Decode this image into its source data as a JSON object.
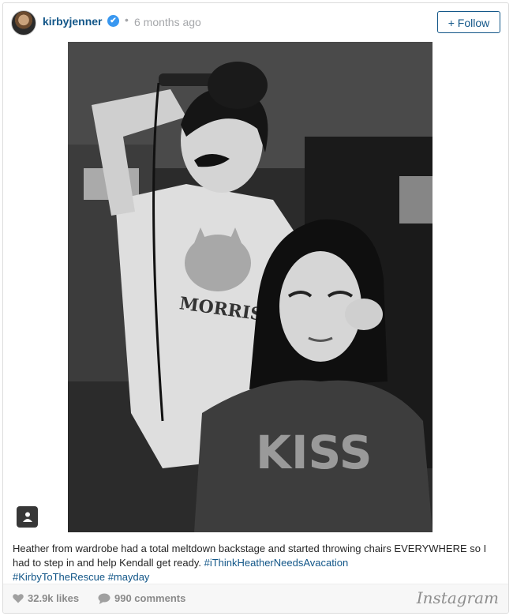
{
  "header": {
    "username": "kirbyjenner",
    "verified_mark": "✔",
    "separator": "•",
    "timestamp": "6 months ago",
    "follow_label": "+ Follow"
  },
  "caption": {
    "text": "Heather from wardrobe had a total meltdown backstage and started throwing chairs EVERYWHERE so I had to step in and help Kendall get ready. ",
    "hashtags": [
      "#iThinkHeatherNeedsAvacation",
      "#KirbyToTheRescue",
      "#mayday"
    ]
  },
  "photo": {
    "shirt_text_1": "MORRIS",
    "shirt_text_2": "KISS"
  },
  "footer": {
    "likes": "32.9k likes",
    "comments": "990 comments",
    "brand": "Instagram"
  },
  "icons": {
    "verified": "verified-badge-icon",
    "user_tag": "user-tag-icon",
    "heart": "heart-icon",
    "comment": "comment-bubble-icon"
  },
  "colors": {
    "link": "#125688",
    "verified": "#3897f0",
    "muted": "#a5a7aa"
  }
}
